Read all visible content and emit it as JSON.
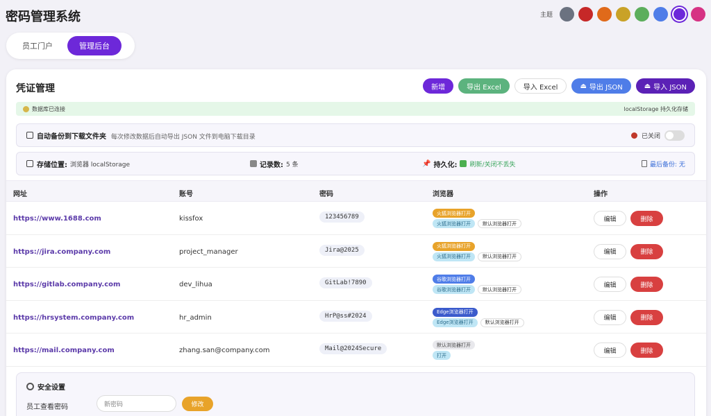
{
  "app": {
    "title": "密码管理系统"
  },
  "theme": {
    "label": "主题",
    "swatches": [
      "#6b7280",
      "#c62828",
      "#e06a1a",
      "#c9a227",
      "#5cae5c",
      "#4f7de8",
      "#6d28d9",
      "#d63384"
    ],
    "active_index": 6
  },
  "portal": {
    "tabs": [
      "员工门户",
      "管理后台"
    ],
    "active": "管理后台"
  },
  "card": {
    "title": "凭证管理",
    "toolbar": {
      "add": "新增",
      "export_excel": "导出 Excel",
      "import_excel": "导入 Excel",
      "export_json": "导出 JSON",
      "import_json": "导入 JSON"
    }
  },
  "db_status": {
    "left": "数据库已连接",
    "right": "localStorage 持久化存储"
  },
  "backup": {
    "title": "自动备份到下载文件夹",
    "desc": "每次修改数据后自动导出 JSON 文件到电脑下载目录",
    "status": "已关闭"
  },
  "storage": {
    "location_label": "存储位置:",
    "location_value": "浏览器 localStorage",
    "count_label": "记录数:",
    "count_value": "5 条",
    "persist_label": "持久化:",
    "persist_value": "刷新/关闭不丢失",
    "last_backup": "最后备份: 无"
  },
  "table": {
    "headers": [
      "网址",
      "账号",
      "密码",
      "浏览器",
      "操作"
    ],
    "edit_label": "编辑",
    "delete_label": "删除",
    "rows": [
      {
        "url": "https://www.1688.com",
        "account": "kissfox",
        "password": "123456789",
        "browser_main": "火狐浏览器打开",
        "browser_alt": "火狐浏览器打开",
        "browser_default": "默认浏览器打开"
      },
      {
        "url": "https://jira.company.com",
        "account": "project_manager",
        "password": "Jira@2025",
        "browser_main": "火狐浏览器打开",
        "browser_alt": "火狐浏览器打开",
        "browser_default": "默认浏览器打开"
      },
      {
        "url": "https://gitlab.company.com",
        "account": "dev_lihua",
        "password": "GitLab!7890",
        "browser_main": "谷歌浏览器打开",
        "browser_alt": "谷歌浏览器打开",
        "browser_default": "默认浏览器打开"
      },
      {
        "url": "https://hrsystem.company.com",
        "account": "hr_admin",
        "password": "HrP@ss#2024",
        "browser_main": "Edge浏览器打开",
        "browser_alt": "Edge浏览器打开",
        "browser_default": "默认浏览器打开"
      },
      {
        "url": "https://mail.company.com",
        "account": "zhang.san@company.com",
        "password": "Mail@2024Secure",
        "browser_main": "默认浏览器打开",
        "browser_alt": "打开"
      }
    ]
  },
  "security": {
    "title": "安全设置",
    "employee_pwd_label": "员工查看密码",
    "new_pwd_placeholder": "新密码",
    "modify_label": "修改"
  }
}
